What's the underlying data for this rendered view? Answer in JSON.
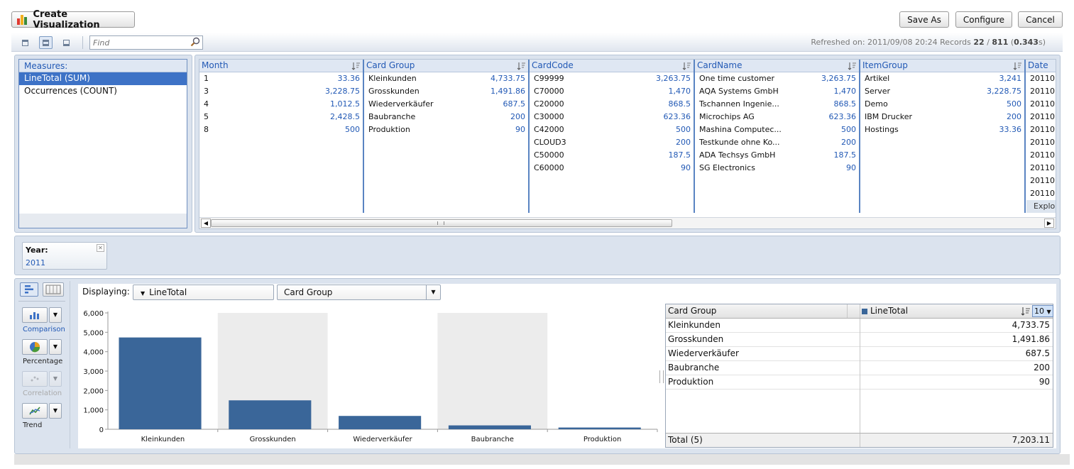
{
  "header": {
    "title_button": "Create Visualization",
    "save_as": "Save As",
    "configure": "Configure",
    "cancel": "Cancel"
  },
  "toolbar": {
    "find_placeholder": "Find",
    "refreshed_prefix": "Refreshed on: ",
    "refreshed_date": "2011/09/08 20:24",
    "records_label": " Records ",
    "records_shown": "22",
    "records_sep": " / ",
    "records_total": "811",
    "time_open": " (",
    "time": "0.343",
    "time_close": "s)"
  },
  "measures": {
    "header": "Measures:",
    "items": [
      "LineTotal (SUM)",
      "Occurrences (COUNT)"
    ]
  },
  "grid": {
    "columns": [
      {
        "header": "Month",
        "rows": [
          [
            "1",
            "33.36"
          ],
          [
            "3",
            "3,228.75"
          ],
          [
            "4",
            "1,012.5"
          ],
          [
            "5",
            "2,428.5"
          ],
          [
            "8",
            "500"
          ]
        ]
      },
      {
        "header": "Card Group",
        "rows": [
          [
            "Kleinkunden",
            "4,733.75"
          ],
          [
            "Grosskunden",
            "1,491.86"
          ],
          [
            "Wiederverkäufer",
            "687.5"
          ],
          [
            "Baubranche",
            "200"
          ],
          [
            "Produktion",
            "90"
          ]
        ]
      },
      {
        "header": "CardCode",
        "rows": [
          [
            "C99999",
            "3,263.75"
          ],
          [
            "C70000",
            "1,470"
          ],
          [
            "C20000",
            "868.5"
          ],
          [
            "C30000",
            "623.36"
          ],
          [
            "C42000",
            "500"
          ],
          [
            "CLOUD3",
            "200"
          ],
          [
            "C50000",
            "187.5"
          ],
          [
            "C60000",
            "90"
          ]
        ]
      },
      {
        "header": "CardName",
        "rows": [
          [
            "One time customer",
            "3,263.75"
          ],
          [
            "AQA Systems GmbH",
            "1,470"
          ],
          [
            "Tschannen Ingenie...",
            "868.5"
          ],
          [
            "Microchips AG",
            "623.36"
          ],
          [
            "Mashina Computec...",
            "500"
          ],
          [
            "Testkunde ohne Ko...",
            "200"
          ],
          [
            "ADA Techsys GmbH",
            "187.5"
          ],
          [
            "SG Electronics",
            "90"
          ]
        ]
      },
      {
        "header": "ItemGroup",
        "rows": [
          [
            "Artikel",
            "3,241"
          ],
          [
            "Server",
            "3,228.75"
          ],
          [
            "Demo",
            "500"
          ],
          [
            "IBM Drucker",
            "200"
          ],
          [
            "Hostings",
            "33.36"
          ]
        ]
      },
      {
        "header": "Date",
        "rows": [
          [
            "20110",
            ""
          ],
          [
            "20110",
            ""
          ],
          [
            "20110",
            ""
          ],
          [
            "20110",
            ""
          ],
          [
            "20110",
            ""
          ],
          [
            "20110",
            ""
          ],
          [
            "20110",
            ""
          ],
          [
            "20110",
            ""
          ],
          [
            "20110",
            ""
          ],
          [
            "20110",
            ""
          ]
        ]
      }
    ],
    "explore_label": "Explor"
  },
  "filter": {
    "label": "Year:",
    "value": "2011"
  },
  "chart_tools": {
    "comparison": "Comparison",
    "percentage": "Percentage",
    "correlation": "Correlation",
    "trend": "Trend"
  },
  "display": {
    "label": "Displaying:",
    "measure": "LineTotal",
    "dimension": "Card Group"
  },
  "chart_data": {
    "type": "bar",
    "categories": [
      "Kleinkunden",
      "Grosskunden",
      "Wiederverkäufer",
      "Baubranche",
      "Produktion"
    ],
    "series": [
      {
        "name": "LineTotal",
        "values": [
          4733.75,
          1491.86,
          687.5,
          200,
          90
        ]
      }
    ],
    "y_ticks": [
      "0",
      "1,000",
      "2,000",
      "3,000",
      "4,000",
      "5,000",
      "6,000"
    ],
    "ylim": [
      0,
      6000
    ],
    "bar_color": "#3a6699",
    "alt_band_color": "#ececec"
  },
  "summary": {
    "col1": "Card Group",
    "col2": "LineTotal",
    "topn": "10",
    "rows": [
      [
        "Kleinkunden",
        "4,733.75"
      ],
      [
        "Grosskunden",
        "1,491.86"
      ],
      [
        "Wiederverkäufer",
        "687.5"
      ],
      [
        "Baubranche",
        "200"
      ],
      [
        "Produktion",
        "90"
      ]
    ],
    "total_label": "Total (5)",
    "total_value": "7,203.11"
  }
}
